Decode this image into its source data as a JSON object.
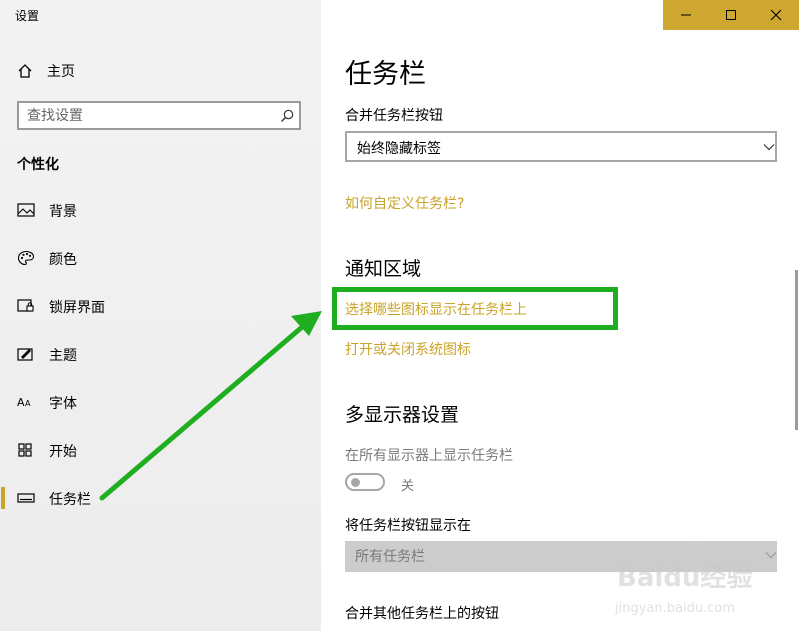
{
  "window": {
    "title": "设置"
  },
  "sidebar": {
    "home_label": "主页",
    "search": {
      "placeholder": "查找设置"
    },
    "section_title": "个性化",
    "items": [
      {
        "label": "背景",
        "icon": "image-icon"
      },
      {
        "label": "颜色",
        "icon": "palette-icon"
      },
      {
        "label": "锁屏界面",
        "icon": "lock-screen-icon"
      },
      {
        "label": "主题",
        "icon": "theme-icon"
      },
      {
        "label": "字体",
        "icon": "font-icon"
      },
      {
        "label": "开始",
        "icon": "start-icon"
      },
      {
        "label": "任务栏",
        "icon": "taskbar-icon",
        "active": true
      }
    ]
  },
  "main": {
    "page_title": "任务栏",
    "combine_label": "合并任务栏按钮",
    "combine_value": "始终隐藏标签",
    "customize_link": "如何自定义任务栏?",
    "notification": {
      "title": "通知区域",
      "link_choose_icons": "选择哪些图标显示在任务栏上",
      "link_system_icons": "打开或关闭系统图标"
    },
    "multi_display": {
      "title": "多显示器设置",
      "show_all_label": "在所有显示器上显示任务栏",
      "toggle_state": "关",
      "show_buttons_label": "将任务栏按钮显示在",
      "show_buttons_value": "所有任务栏",
      "combine_other_label": "合并其他任务栏上的按钮"
    }
  },
  "colors": {
    "accent": "#c9a32a",
    "annotation": "#1fae1f",
    "titlebar": "#cda730"
  },
  "watermark": {
    "text_main": "Baidu经验",
    "text_sub": "jingyan.baidu.com"
  }
}
